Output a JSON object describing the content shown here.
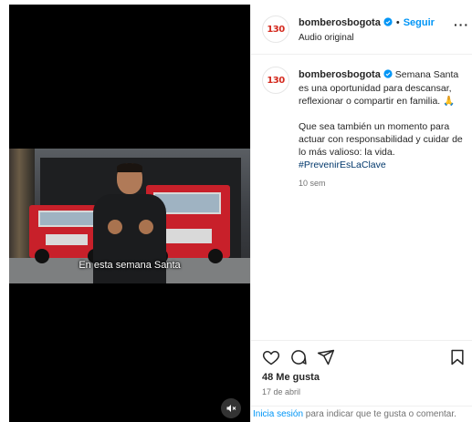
{
  "video": {
    "caption": "En esta semana Santa",
    "mute_icon": "speaker-muted-icon"
  },
  "account": {
    "avatar_text": "130",
    "username": "bomberosbogota",
    "separator": "•",
    "follow_label": "Seguir",
    "audio_label": "Audio original",
    "more_label": "···"
  },
  "caption": {
    "username": "bomberosbogota",
    "paragraph1": "Semana Santa es una oportunidad para descansar, reflexionar o compartir en familia. 🙏",
    "paragraph2": "Que sea también un momento para actuar con responsabilidad y cuidar de lo más valioso: la vida.",
    "hashtag": "#PrevenirEsLaClave",
    "time_ago": "10 sem"
  },
  "actions": {
    "like_icon": "heart-icon",
    "comment_icon": "comment-icon",
    "share_icon": "send-icon",
    "save_icon": "bookmark-icon"
  },
  "stats": {
    "likes": "48 Me gusta",
    "date": "17 de abril"
  },
  "login_prompt": {
    "link": "Inicia sesión",
    "text": " para indicar que te gusta o comentar."
  },
  "colors": {
    "accent": "#0095f6",
    "hashtag": "#00376b",
    "brand_red": "#d42a1e",
    "muted_text": "#737373"
  }
}
